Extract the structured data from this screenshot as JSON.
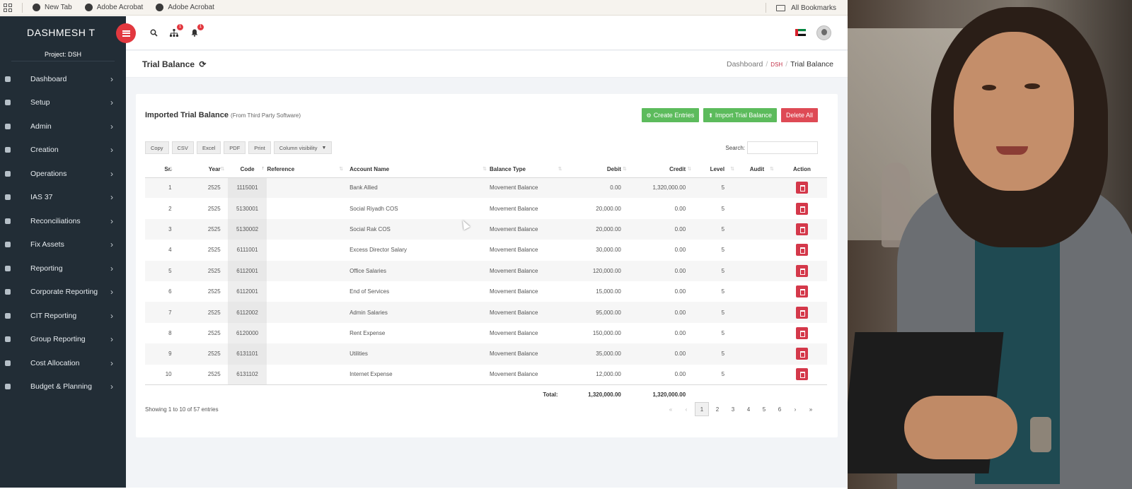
{
  "browser": {
    "bookmarks": [
      {
        "label": "New Tab",
        "icon": "chrome-icon"
      },
      {
        "label": "Adobe Acrobat",
        "icon": "acrobat-icon"
      },
      {
        "label": "Adobe Acrobat",
        "icon": "acrobat-icon"
      }
    ],
    "all_bookmarks": "All Bookmarks"
  },
  "sidebar": {
    "brand": "DASHMESH T",
    "project": "Project: DSH",
    "items": [
      {
        "label": "Dashboard"
      },
      {
        "label": "Setup"
      },
      {
        "label": "Admin"
      },
      {
        "label": "Creation"
      },
      {
        "label": "Operations"
      },
      {
        "label": "IAS 37"
      },
      {
        "label": "Reconciliations"
      },
      {
        "label": "Fix Assets"
      },
      {
        "label": "Reporting"
      },
      {
        "label": "Corporate Reporting"
      },
      {
        "label": "CIT Reporting"
      },
      {
        "label": "Group Reporting"
      },
      {
        "label": "Cost Allocation"
      },
      {
        "label": "Budget & Planning"
      }
    ]
  },
  "topbar": {
    "hierarchy_badge": "1",
    "notification_badge": "1"
  },
  "page": {
    "title": "Trial Balance",
    "breadcrumb": {
      "home": "Dashboard",
      "project": "DSH",
      "current": "Trial Balance"
    }
  },
  "card": {
    "title": "Imported Trial Balance",
    "subtitle": "(From Third Party Software)",
    "create_entries": "Create Entries",
    "import_trial_balance": "Import Trial Balance",
    "delete_all": "Delete All",
    "exports": [
      "Copy",
      "CSV",
      "Excel",
      "PDF",
      "Print"
    ],
    "column_visibility": "Column visibility",
    "search_label": "Search:",
    "search_value": ""
  },
  "table": {
    "headers": {
      "sr": "Sr.",
      "year": "Year",
      "code": "Code",
      "reference": "Reference",
      "account": "Account Name",
      "balance_type": "Balance Type",
      "debit": "Debit",
      "credit": "Credit",
      "level": "Level",
      "audit": "Audit",
      "action": "Action"
    },
    "rows": [
      {
        "sr": "1",
        "year": "2525",
        "code": "1115001",
        "reference": "",
        "account": "Bank Allied",
        "balance_type": "Movement Balance",
        "debit": "0.00",
        "credit": "1,320,000.00",
        "level": "5",
        "audit": ""
      },
      {
        "sr": "2",
        "year": "2525",
        "code": "5130001",
        "reference": "",
        "account": "Social Riyadh COS",
        "balance_type": "Movement Balance",
        "debit": "20,000.00",
        "credit": "0.00",
        "level": "5",
        "audit": ""
      },
      {
        "sr": "3",
        "year": "2525",
        "code": "5130002",
        "reference": "",
        "account": "Social Rak COS",
        "balance_type": "Movement Balance",
        "debit": "20,000.00",
        "credit": "0.00",
        "level": "5",
        "audit": ""
      },
      {
        "sr": "4",
        "year": "2525",
        "code": "6111001",
        "reference": "",
        "account": "Excess Director Salary",
        "balance_type": "Movement Balance",
        "debit": "30,000.00",
        "credit": "0.00",
        "level": "5",
        "audit": ""
      },
      {
        "sr": "5",
        "year": "2525",
        "code": "6112001",
        "reference": "",
        "account": "Office Salaries",
        "balance_type": "Movement Balance",
        "debit": "120,000.00",
        "credit": "0.00",
        "level": "5",
        "audit": ""
      },
      {
        "sr": "6",
        "year": "2525",
        "code": "6112001",
        "reference": "",
        "account": "End of Services",
        "balance_type": "Movement Balance",
        "debit": "15,000.00",
        "credit": "0.00",
        "level": "5",
        "audit": ""
      },
      {
        "sr": "7",
        "year": "2525",
        "code": "6112002",
        "reference": "",
        "account": "Admin Salaries",
        "balance_type": "Movement Balance",
        "debit": "95,000.00",
        "credit": "0.00",
        "level": "5",
        "audit": ""
      },
      {
        "sr": "8",
        "year": "2525",
        "code": "6120000",
        "reference": "",
        "account": "Rent Expense",
        "balance_type": "Movement Balance",
        "debit": "150,000.00",
        "credit": "0.00",
        "level": "5",
        "audit": ""
      },
      {
        "sr": "9",
        "year": "2525",
        "code": "6131101",
        "reference": "",
        "account": "Utilities",
        "balance_type": "Movement Balance",
        "debit": "35,000.00",
        "credit": "0.00",
        "level": "5",
        "audit": ""
      },
      {
        "sr": "10",
        "year": "2525",
        "code": "6131102",
        "reference": "",
        "account": "Internet Expense",
        "balance_type": "Movement Balance",
        "debit": "12,000.00",
        "credit": "0.00",
        "level": "5",
        "audit": ""
      }
    ],
    "total_label": "Total:",
    "total_debit": "1,320,000.00",
    "total_credit": "1,320,000.00"
  },
  "pagination": {
    "info": "Showing 1 to 10 of 57 entries",
    "first": "«",
    "prev": "‹",
    "next": "›",
    "last": "»",
    "pages": [
      "1",
      "2",
      "3",
      "4",
      "5",
      "6"
    ],
    "current": "1"
  },
  "colors": {
    "sidebar_bg": "#222d36",
    "accent_red": "#e2383f",
    "success_green": "#5cbb5c",
    "danger_red": "#de4a55"
  }
}
